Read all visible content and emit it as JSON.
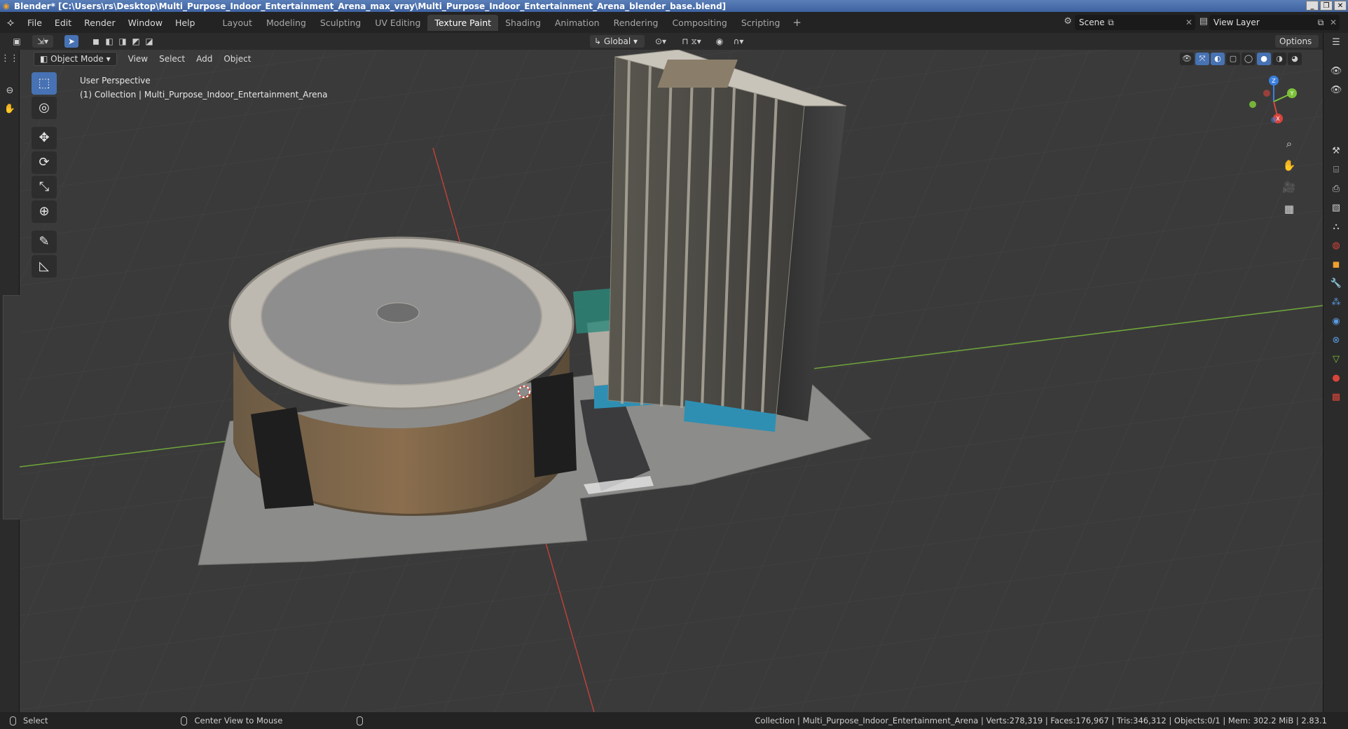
{
  "window": {
    "title": "Blender* [C:\\Users\\rs\\Desktop\\Multi_Purpose_Indoor_Entertainment_Arena_max_vray\\Multi_Purpose_Indoor_Entertainment_Arena_blender_base.blend]",
    "buttons": [
      "_",
      "❐",
      "✕"
    ]
  },
  "menus": [
    "File",
    "Edit",
    "Render",
    "Window",
    "Help"
  ],
  "workspaces": {
    "tabs": [
      "Layout",
      "Modeling",
      "Sculpting",
      "UV Editing",
      "Texture Paint",
      "Shading",
      "Animation",
      "Rendering",
      "Compositing",
      "Scripting"
    ],
    "active": "Texture Paint",
    "add_label": "+"
  },
  "scene": {
    "name": "Scene",
    "view_layer": "View Layer"
  },
  "header": {
    "transform_orientation": "Global",
    "options_label": "Options"
  },
  "viewport": {
    "mode": "Object Mode",
    "menus": [
      "View",
      "Select",
      "Add",
      "Object"
    ],
    "perspective": "User Perspective",
    "collection_info": "(1) Collection | Multi_Purpose_Indoor_Entertainment_Arena",
    "gizmo_axes": [
      "Z",
      "Y",
      "X"
    ]
  },
  "tools": [
    {
      "name": "select-box-tool",
      "glyph": "⬚",
      "active": true
    },
    {
      "name": "cursor-tool",
      "glyph": "◎",
      "active": false
    },
    {
      "name": "move-tool",
      "glyph": "✥",
      "active": false
    },
    {
      "name": "rotate-tool",
      "glyph": "⟳",
      "active": false
    },
    {
      "name": "scale-tool",
      "glyph": "⤡",
      "active": false
    },
    {
      "name": "transform-tool",
      "glyph": "⊕",
      "active": false
    },
    {
      "name": "annotate-tool",
      "glyph": "✎",
      "active": false
    },
    {
      "name": "measure-tool",
      "glyph": "📐",
      "active": false
    }
  ],
  "status": {
    "left_action": "Select",
    "middle_action": "Center View to Mouse",
    "stats": "Collection | Multi_Purpose_Indoor_Entertainment_Arena | Verts:278,319 | Faces:176,967 | Tris:346,312 | Objects:0/1 | Mem: 302.2 MiB | 2.83.1"
  },
  "colors": {
    "accent": "#4772b3",
    "viewport_bg": "#3a3a3a",
    "axis_x": "#d9453b",
    "axis_y": "#7dc23a",
    "axis_z": "#3b7fe0"
  }
}
